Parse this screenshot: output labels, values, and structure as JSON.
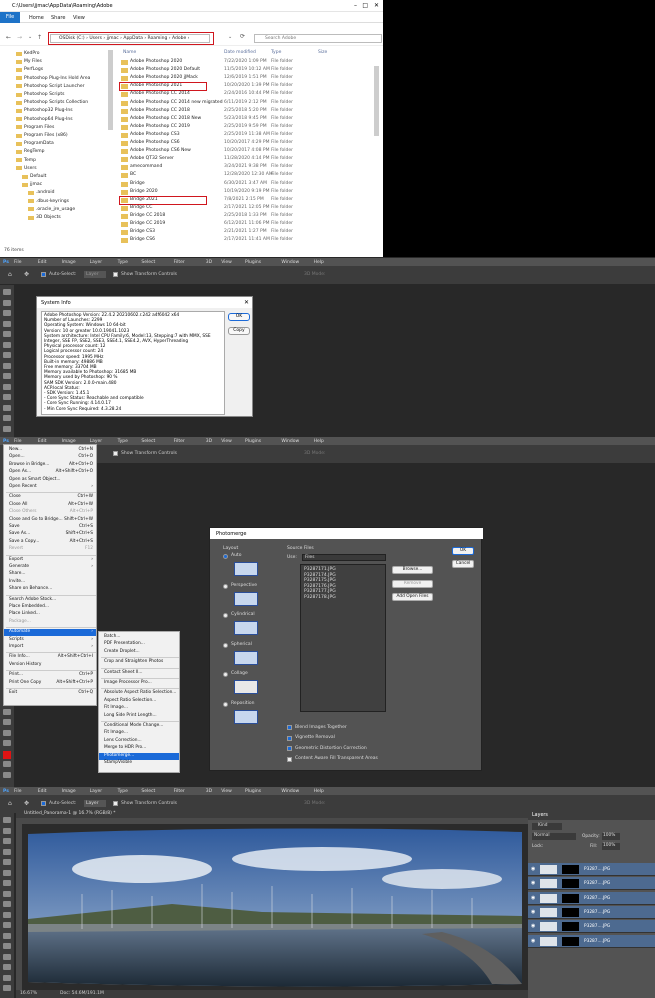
{
  "explorer": {
    "title": "C:\\Users\\jjmac\\AppData\\Roaming\\Adobe",
    "ribbon": {
      "file": "File",
      "tabs": [
        "Home",
        "Share",
        "View"
      ]
    },
    "address": "OSDisk (C:)  ›  Users  ›  jjmac  ›  AppData  ›  Roaming  ›  Adobe  ›",
    "search_placeholder": "Search Adobe",
    "nav_items": [
      "KedPro",
      "My Files",
      "PerfLogs",
      "Photoshop Plug-Ins Hold Area",
      "Photoshop Script Launcher",
      "Photoshop Scripts",
      "Photoshop Scripts Collection",
      "Photoshop32 Plug-Ins",
      "Photoshop64 Plug-Ins",
      "Program Files",
      "Program Files (x86)",
      "ProgramData",
      "RegTemp",
      "Temp",
      "Users",
      "Default",
      "jjmac",
      ".android",
      ".dbus-keyrings",
      ".oracle_jre_usage",
      "3D Objects"
    ],
    "columns": [
      "Name",
      "Date modified",
      "Type",
      "Size"
    ],
    "rows": [
      {
        "name": "Adobe Photoshop 2020",
        "date": "7/22/2020 1:09 PM",
        "type": "File folder"
      },
      {
        "name": "Adobe Photoshop 2020 Default",
        "date": "11/5/2019 10:12 AM",
        "type": "File folder"
      },
      {
        "name": "Adobe Photoshop 2020 jJMack",
        "date": "12/6/2019 1:51 PM",
        "type": "File folder"
      },
      {
        "name": "Adobe Photoshop 2021",
        "date": "10/20/2020 1:39 PM",
        "type": "File folder"
      },
      {
        "name": "Adobe Photoshop CC 2014",
        "date": "2/24/2016 10:44 PM",
        "type": "File folder"
      },
      {
        "name": "Adobe Photoshop CC 2014 new migrated",
        "date": "6/11/2019 2:12 PM",
        "type": "File folder"
      },
      {
        "name": "Adobe Photoshop CC 2018",
        "date": "2/25/2018 5:20 PM",
        "type": "File folder"
      },
      {
        "name": "Adobe Photoshop CC 2018 New",
        "date": "5/23/2018 9:45 PM",
        "type": "File folder"
      },
      {
        "name": "Adobe Photoshop CC 2019",
        "date": "2/25/2019 9:59 PM",
        "type": "File folder"
      },
      {
        "name": "Adobe Photoshop CS3",
        "date": "2/25/2019 11:38 AM",
        "type": "File folder"
      },
      {
        "name": "Adobe Photoshop CS6",
        "date": "10/20/2017 4:29 PM",
        "type": "File folder"
      },
      {
        "name": "Adobe Photoshop CS6 New",
        "date": "10/20/2017 4:08 PM",
        "type": "File folder"
      },
      {
        "name": "Adobe QT32 Server",
        "date": "11/28/2020 4:14 PM",
        "type": "File folder"
      },
      {
        "name": "amecommand",
        "date": "3/24/2021 9:38 PM",
        "type": "File folder"
      },
      {
        "name": "BC",
        "date": "12/28/2020 12:30 AM",
        "type": "File folder"
      },
      {
        "name": "Bridge",
        "date": "6/30/2021 3:47 AM",
        "type": "File folder"
      },
      {
        "name": "Bridge 2020",
        "date": "10/19/2020 9:19 PM",
        "type": "File folder"
      },
      {
        "name": "Bridge 2021",
        "date": "7/8/2021 2:15 PM",
        "type": "File folder"
      },
      {
        "name": "Bridge CC",
        "date": "2/17/2021 12:05 PM",
        "type": "File folder"
      },
      {
        "name": "Bridge CC 2018",
        "date": "2/25/2018 1:33 PM",
        "type": "File folder"
      },
      {
        "name": "Bridge CC 2019",
        "date": "6/12/2021 11:06 PM",
        "type": "File folder"
      },
      {
        "name": "Bridge CS3",
        "date": "2/21/2021 1:27 PM",
        "type": "File folder"
      },
      {
        "name": "Bridge CS6",
        "date": "2/17/2021 11:41 AM",
        "type": "File folder"
      }
    ],
    "status": "76 items"
  },
  "ps_menus": [
    "Ps",
    "File",
    "Edit",
    "Image",
    "Layer",
    "Type",
    "Select",
    "Filter",
    "3D",
    "View",
    "Plugins",
    "Window",
    "Help"
  ],
  "options": {
    "auto_select": "Auto-Select:",
    "layer": "Layer",
    "transform": "Show Transform Controls",
    "mode3d": "3D Mode:"
  },
  "sysinfo": {
    "title": "System Info",
    "ok": "OK",
    "copy": "Copy",
    "lines": [
      "Adobe Photoshop Version: 22.4.2 20210602.r.242 a4f6042  x64",
      "Number of Launches: 2299",
      "Operating System: Windows 10 64-bit",
      "Version: 10 or greater 10.0.19041.1023",
      "System architecture: Intel CPU Family:6, Model:13, Stepping:7 with MMX, SSE Integer, SSE FP, SSE2, SSE3, SSE4.1, SSE4.2, AVX, HyperThreading",
      "Physical processor count: 12",
      "Logical processor count: 24",
      "Processor speed: 1995 MHz",
      "Built-in memory: 49886 MB",
      "Free memory: 33704 MB",
      "Memory available to Photoshop: 31685 MB",
      "Memory used by Photoshop: 90 %",
      "SAM SDK Version: 2.0.0-main.480",
      "ACP.local Status:",
      "- SDK Version: 1.45.1",
      "- Core Sync Status: Reachable and compatible",
      "- Core Sync Running: 4.14.0.17",
      "- Min Core Sync Required: 4.3.28.24"
    ]
  },
  "file_menu": [
    {
      "label": "New...",
      "sc": "Ctrl+N"
    },
    {
      "label": "Open...",
      "sc": "Ctrl+O"
    },
    {
      "label": "Browse in Bridge...",
      "sc": "Alt+Ctrl+O"
    },
    {
      "label": "Open As...",
      "sc": "Alt+Shift+Ctrl+O"
    },
    {
      "label": "Open as Smart Object...",
      "sc": ""
    },
    {
      "label": "Open Recent",
      "sc": "›"
    },
    {
      "label": "Close",
      "sc": "Ctrl+W"
    },
    {
      "label": "Close All",
      "sc": "Alt+Ctrl+W"
    },
    {
      "label": "Close Others",
      "sc": "Alt+Ctrl+P"
    },
    {
      "label": "Close and Go to Bridge...",
      "sc": "Shift+Ctrl+W"
    },
    {
      "label": "Save",
      "sc": "Ctrl+S"
    },
    {
      "label": "Save As...",
      "sc": "Shift+Ctrl+S"
    },
    {
      "label": "Save a Copy...",
      "sc": "Alt+Ctrl+S"
    },
    {
      "label": "Revert",
      "sc": "F12"
    },
    {
      "label": "Export",
      "sc": "›"
    },
    {
      "label": "Generate",
      "sc": "›"
    },
    {
      "label": "Share...",
      "sc": ""
    },
    {
      "label": "Invite...",
      "sc": ""
    },
    {
      "label": "Share on Behance...",
      "sc": ""
    },
    {
      "label": "Search Adobe Stock...",
      "sc": ""
    },
    {
      "label": "Place Embedded...",
      "sc": ""
    },
    {
      "label": "Place Linked...",
      "sc": ""
    },
    {
      "label": "Package...",
      "sc": ""
    },
    {
      "label": "Automate",
      "sc": "›"
    },
    {
      "label": "Scripts",
      "sc": "›"
    },
    {
      "label": "Import",
      "sc": "›"
    },
    {
      "label": "File Info...",
      "sc": "Alt+Shift+Ctrl+I"
    },
    {
      "label": "Version History",
      "sc": ""
    },
    {
      "label": "Print...",
      "sc": "Ctrl+P"
    },
    {
      "label": "Print One Copy",
      "sc": "Alt+Shift+Ctrl+P"
    },
    {
      "label": "Exit",
      "sc": "Ctrl+Q"
    }
  ],
  "automate_menu": [
    "Batch...",
    "PDF Presentation...",
    "Create Droplet...",
    "Crop and Straighten Photos",
    "Contact Sheet II...",
    "Image Processor Pro...",
    "Absolute Aspect Ratio Selection...",
    "Aspect Ratio Selection...",
    "Fit Image...",
    "Long Side Print Length...",
    "Conditional Mode Change...",
    "Fit Image...",
    "Lens Correction...",
    "Merge to HDR Pro...",
    "Photomerge...",
    "StampVisible"
  ],
  "photomerge": {
    "title": "Photomerge",
    "layout": "Layout",
    "layouts": [
      "Auto",
      "Perspective",
      "Cylindrical",
      "Spherical",
      "Collage",
      "Reposition"
    ],
    "source_files": "Source Files",
    "use": "Use:",
    "use_value": "Files",
    "files": [
      "P3287171.JPG",
      "P3287174.JPG",
      "P3287175.JPG",
      "P3287176.JPG",
      "P3287177.JPG",
      "P3287178.JPG"
    ],
    "browse": "Browse...",
    "remove": "Remove",
    "add_open": "Add Open Files",
    "ok": "OK",
    "cancel": "Cancel",
    "options": [
      "Blend Images Together",
      "Vignette Removal",
      "Geometric Distortion Correction",
      "Content Aware Fill Transparent Areas"
    ]
  },
  "document": {
    "tab": "Untitled_Panorama-1 @ 16.7% (RGB/8) *",
    "zoom": "16.67%",
    "doc_size": "Doc: 54.6M/191.1M"
  },
  "layers": {
    "title": "Layers",
    "kind": "Kind",
    "mode": "Normal",
    "opacity_label": "Opacity:",
    "opacity": "100%",
    "lock": "Lock:",
    "fill_label": "Fill:",
    "fill": "100%",
    "items": [
      "P3287....JPG",
      "P3287....JPG",
      "P3287....JPG",
      "P3287....JPG",
      "P3287....JPG",
      "P3287....JPG"
    ]
  }
}
